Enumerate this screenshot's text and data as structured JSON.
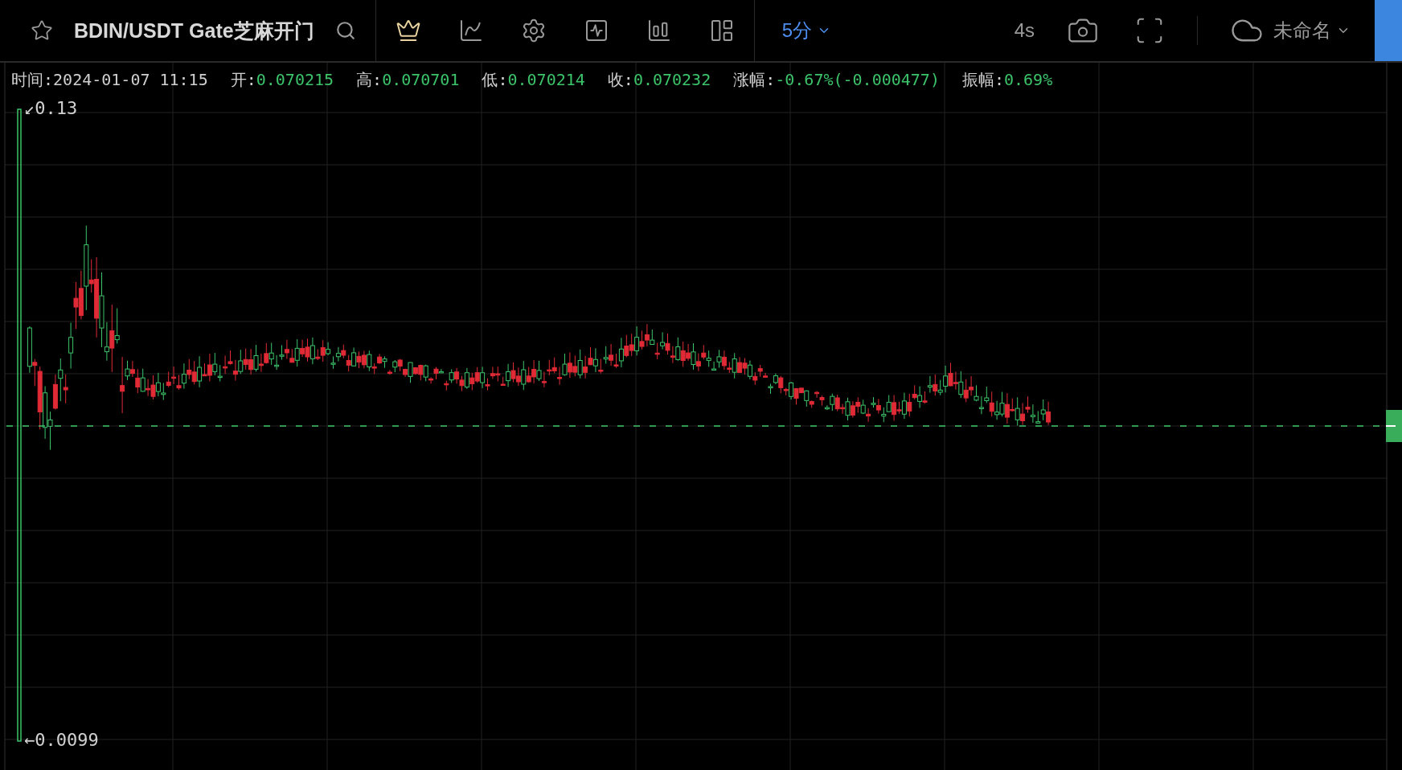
{
  "toolbar": {
    "symbol": "BDIN/USDT Gate芝麻开门",
    "favorite": false,
    "timeframes": [
      {
        "label": "5分",
        "selected": true
      }
    ],
    "refresh": "4s",
    "layout_name": "未命名"
  },
  "info": [
    {
      "kind": "time",
      "label": "时间:",
      "value": "2024-01-07 11:15"
    },
    {
      "kind": "price",
      "label": "开:",
      "value": "0.070215"
    },
    {
      "kind": "price",
      "label": "高:",
      "value": "0.070701"
    },
    {
      "kind": "price",
      "label": "低:",
      "value": "0.070214"
    },
    {
      "kind": "price",
      "label": "收:",
      "value": "0.070232"
    },
    {
      "kind": "price",
      "label": "涨幅:",
      "value": "-0.67%(-0.000477)"
    },
    {
      "kind": "price",
      "label": "振幅:",
      "value": "0.69%"
    }
  ],
  "chart": {
    "max_label": "↙0.13",
    "min_label": "←0.0099"
  }
}
